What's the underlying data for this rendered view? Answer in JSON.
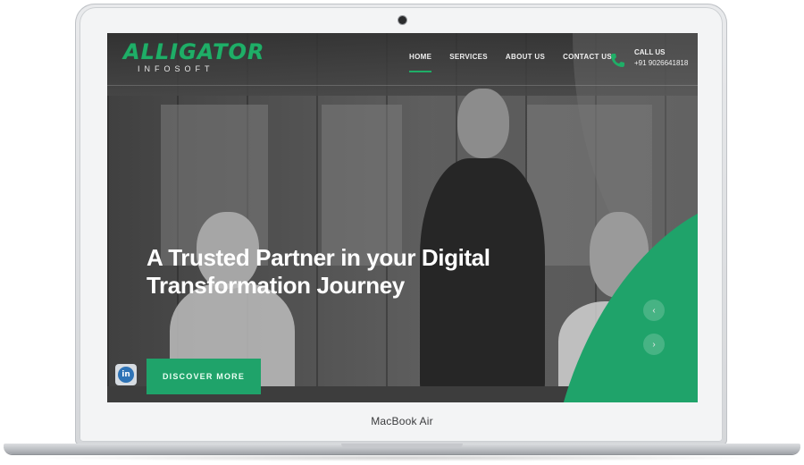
{
  "device": {
    "label": "MacBook Air"
  },
  "site": {
    "logo": {
      "main": "ALLIGATOR",
      "sub": "INFOSOFT"
    },
    "nav": [
      {
        "label": "HOME",
        "active": true
      },
      {
        "label": "SERVICES",
        "active": false
      },
      {
        "label": "ABOUT US",
        "active": false
      },
      {
        "label": "CONTACT US",
        "active": false
      }
    ],
    "call": {
      "label": "CALL US",
      "number": "+91 9026641818"
    },
    "hero": {
      "title_line1": "A Trusted Partner in your Digital",
      "title_line2": "Transformation Journey",
      "cta": "DISCOVER MORE"
    },
    "social": {
      "linkedin": "in"
    },
    "slider": {
      "prev": "‹",
      "next": "›"
    }
  },
  "colors": {
    "brand_green": "#1fa36a",
    "text_light": "#ffffff"
  },
  "icons": [
    "camera-dot",
    "phone-icon",
    "linkedin-icon",
    "chevron-left-icon",
    "chevron-right-icon"
  ]
}
